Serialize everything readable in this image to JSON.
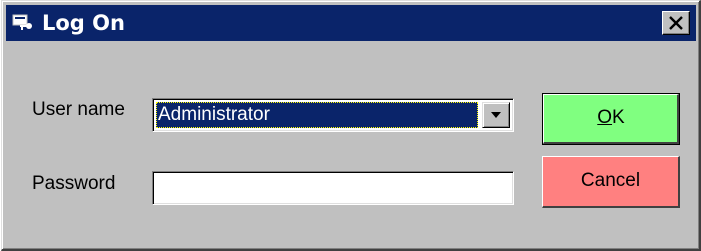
{
  "window": {
    "title": "Log On",
    "icon": "key-window-icon",
    "close_icon": "close-icon"
  },
  "form": {
    "username_label": "User name",
    "username_value": "Administrator",
    "username_dropdown_icon": "chevron-down-icon",
    "password_label": "Password",
    "password_value": ""
  },
  "buttons": {
    "ok_accel": "O",
    "ok_rest": "K",
    "cancel_label": "Cancel"
  },
  "colors": {
    "titlebar": "#0a246a",
    "dialog_bg": "#c0c0c0",
    "ok_button": "#80ff80",
    "cancel_button": "#ff8080",
    "selection": "#0a246a"
  }
}
